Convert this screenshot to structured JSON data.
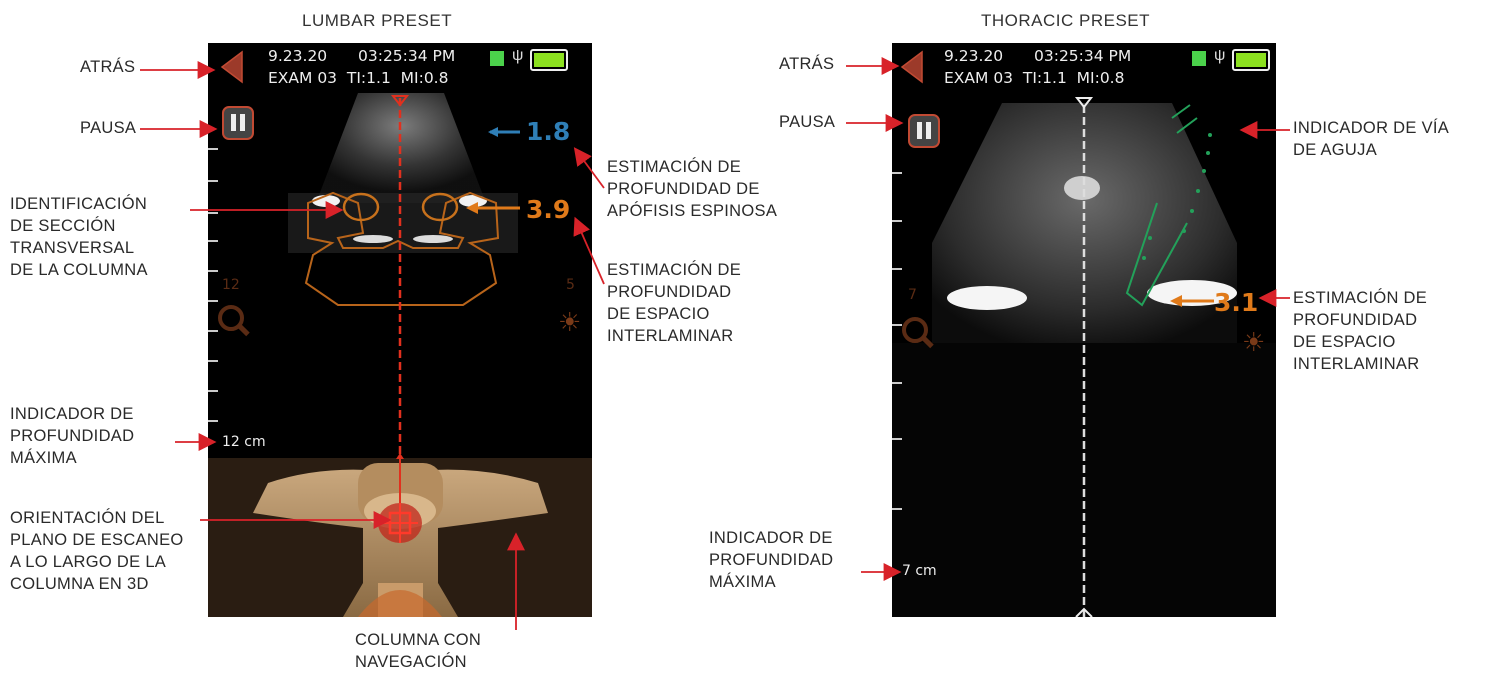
{
  "panels": {
    "lumbar": {
      "title": "LUMBAR PRESET",
      "date": "9.23.20",
      "time": "03:25:34 PM",
      "exam_info": "EXAM 03  TI:1.1  MI:0.8",
      "depth_spinous": "1.8",
      "depth_interlaminar": "3.9",
      "zoom_level": "12",
      "gain_level": "5",
      "max_depth": "12 cm"
    },
    "thoracic": {
      "title": "THORACIC PRESET",
      "date": "9.23.20",
      "time": "03:25:34 PM",
      "exam_info": "EXAM 03  TI:1.1  MI:0.8",
      "depth_interlaminar": "3.1",
      "zoom_level": "7",
      "max_depth": "7 cm"
    }
  },
  "annotations": {
    "back_left": "ATRÁS",
    "pause_left": "PAUSA",
    "cross_section": "IDENTIFICACIÓN\nDE SECCIÓN\nTRANSVERSAL\nDE LA COLUMNA",
    "max_depth_left": "INDICADOR DE\nPROFUNDIDAD\nMÁXIMA",
    "scan_plane": "ORIENTACIÓN DEL\nPLANO DE ESCANEO\nA LO LARGO DE LA\nCOLUMNA EN 3D",
    "spine_nav": "COLUMNA CON\nNAVEGACIÓN",
    "spinous_depth": "ESTIMACIÓN DE\nPROFUNDIDAD DE\nAPÓFISIS ESPINOSA",
    "interlaminar_left": "ESTIMACIÓN DE\nPROFUNDIDAD\nDE ESPACIO\nINTERLAMINAR",
    "back_right": "ATRÁS",
    "pause_right": "PAUSA",
    "max_depth_right": "INDICADOR DE\nPROFUNDIDAD\nMÁXIMA",
    "needle_path": "INDICADOR DE VÍA\nDE AGUJA",
    "interlaminar_right": "ESTIMACIÓN DE\nPROFUNDIDAD\nDE ESPACIO\nINTERLAMINAR"
  },
  "colors": {
    "arrow": "#d82229",
    "orange": "#e07a1a",
    "blue": "#2f7fb7",
    "green": "#23a15a"
  },
  "icons": [
    "back-triangle-icon",
    "pause-icon",
    "magnifier-icon",
    "gain-sun-icon",
    "sd-card-icon",
    "usb-icon",
    "battery-icon"
  ]
}
